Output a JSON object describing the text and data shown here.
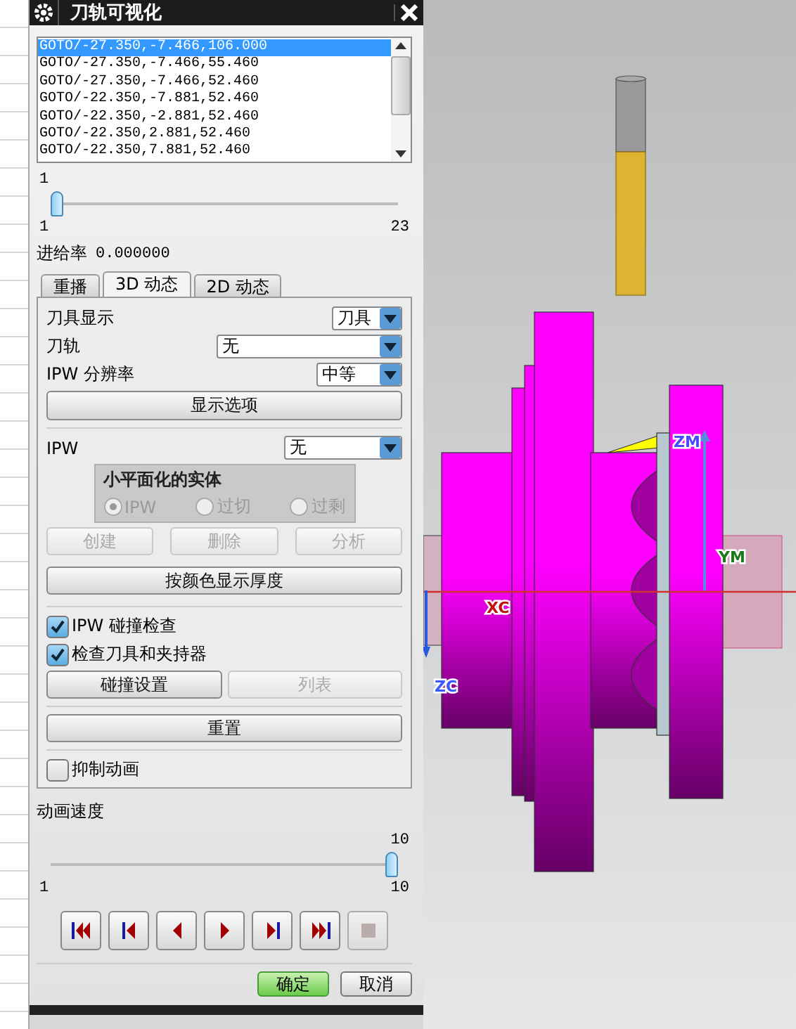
{
  "window": {
    "title": "刀轨可视化"
  },
  "path_list": {
    "items": [
      {
        "text": "GOTO/-27.350,-7.466,106.000",
        "selected": true
      },
      {
        "text": "GOTO/-27.350,-7.466,55.460",
        "selected": false
      },
      {
        "text": "GOTO/-27.350,-7.466,52.460",
        "selected": false
      },
      {
        "text": "GOTO/-22.350,-7.881,52.460",
        "selected": false
      },
      {
        "text": "GOTO/-22.350,-2.881,52.460",
        "selected": false
      },
      {
        "text": "GOTO/-22.350,2.881,52.460",
        "selected": false
      },
      {
        "text": "GOTO/-22.350,7.881,52.460",
        "selected": false
      }
    ]
  },
  "step_slider": {
    "value_label": "1",
    "min_label": "1",
    "max_label": "23",
    "level": 0
  },
  "feed_rate": {
    "label": "进给率",
    "value": "0.000000"
  },
  "tabs": [
    {
      "label": "重播",
      "selected": false
    },
    {
      "label": "3D 动态",
      "selected": true
    },
    {
      "label": "2D 动态",
      "selected": false
    }
  ],
  "tool_display": {
    "label": "刀具显示",
    "value": "刀具"
  },
  "toolpath": {
    "label": "刀轨",
    "value": "无"
  },
  "ipw_resolution": {
    "label": "IPW 分辨率",
    "value": "中等"
  },
  "display_options_button": "显示选项",
  "ipw": {
    "label": "IPW",
    "value": "无"
  },
  "facet_group": {
    "title": "小平面化的实体",
    "disabled": true,
    "options": [
      {
        "label": "IPW",
        "selected": true
      },
      {
        "label": "过切",
        "selected": false
      },
      {
        "label": "过剩",
        "selected": false
      }
    ]
  },
  "ipw_buttons": [
    {
      "label": "创建",
      "disabled": true
    },
    {
      "label": "删除",
      "disabled": true
    },
    {
      "label": "分析",
      "disabled": true
    }
  ],
  "thickness_button": "按颜色显示厚度",
  "checks": [
    {
      "label": "IPW 碰撞检查",
      "checked": true
    },
    {
      "label": "检查刀具和夹持器",
      "checked": true
    }
  ],
  "collision_buttons": [
    {
      "label": "碰撞设置",
      "disabled": false
    },
    {
      "label": "列表",
      "disabled": true
    }
  ],
  "reset_button": "重置",
  "suppress_animation": {
    "label": "抑制动画",
    "checked": false
  },
  "animation_speed": {
    "label": "动画速度",
    "value_label": "10",
    "min_label": "1",
    "max_label": "10",
    "level": 1
  },
  "playback_buttons": [
    {
      "kind": "first",
      "disabled": false
    },
    {
      "kind": "step-back",
      "disabled": false
    },
    {
      "kind": "back",
      "disabled": false
    },
    {
      "kind": "play",
      "disabled": false
    },
    {
      "kind": "step-forward",
      "disabled": false
    },
    {
      "kind": "last",
      "disabled": false
    },
    {
      "kind": "stop",
      "disabled": true
    }
  ],
  "footer_buttons": [
    {
      "label": "确定",
      "kind": "primary"
    },
    {
      "label": "取消",
      "kind": "normal"
    }
  ],
  "viewport": {
    "axis_labels": [
      {
        "text": "ZM",
        "color": "#4a4aff"
      },
      {
        "text": "YM",
        "color": "#1a7a1a"
      },
      {
        "text": "XC",
        "color": "#c01010"
      },
      {
        "text": "ZC",
        "color": "#3a5aff"
      }
    ]
  }
}
